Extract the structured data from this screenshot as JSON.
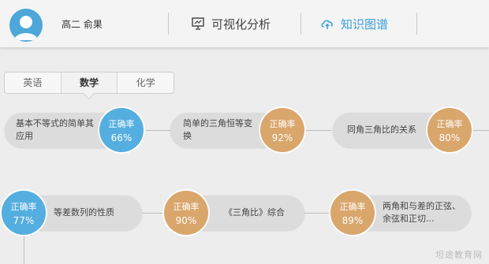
{
  "header": {
    "user_name": "高二  俞果",
    "nav": [
      {
        "label": "可视化分析",
        "icon": "chart-board-icon"
      },
      {
        "label": "知识图谱",
        "icon": "cloud-upload-icon"
      }
    ]
  },
  "tabs": [
    {
      "label": "英语",
      "active": false
    },
    {
      "label": "数学",
      "active": true
    },
    {
      "label": "化学",
      "active": false
    }
  ],
  "nodes": [
    {
      "topic": "基本不等式的简单其应用",
      "label": "正确率",
      "value": "66%",
      "color": "blue"
    },
    {
      "topic": "简单的三角恒等变换",
      "label": "正确率",
      "value": "92%",
      "color": "tan"
    },
    {
      "topic": "同角三角比的关系",
      "label": "正确率",
      "value": "80%",
      "color": "tan"
    },
    {
      "topic": "等差数列的性质",
      "label": "正确率",
      "value": "77%",
      "color": "blue"
    },
    {
      "topic": "《三角比》综合",
      "label": "正确率",
      "value": "90%",
      "color": "tan"
    },
    {
      "topic": "两角和与差的正弦、余弦和正切...",
      "label": "正确率",
      "value": "89%",
      "color": "tan"
    }
  ],
  "colors": {
    "blue": "#55aee0",
    "tan": "#d9a66c",
    "accent": "#3aa0dc"
  },
  "watermark": "坦途教育网"
}
